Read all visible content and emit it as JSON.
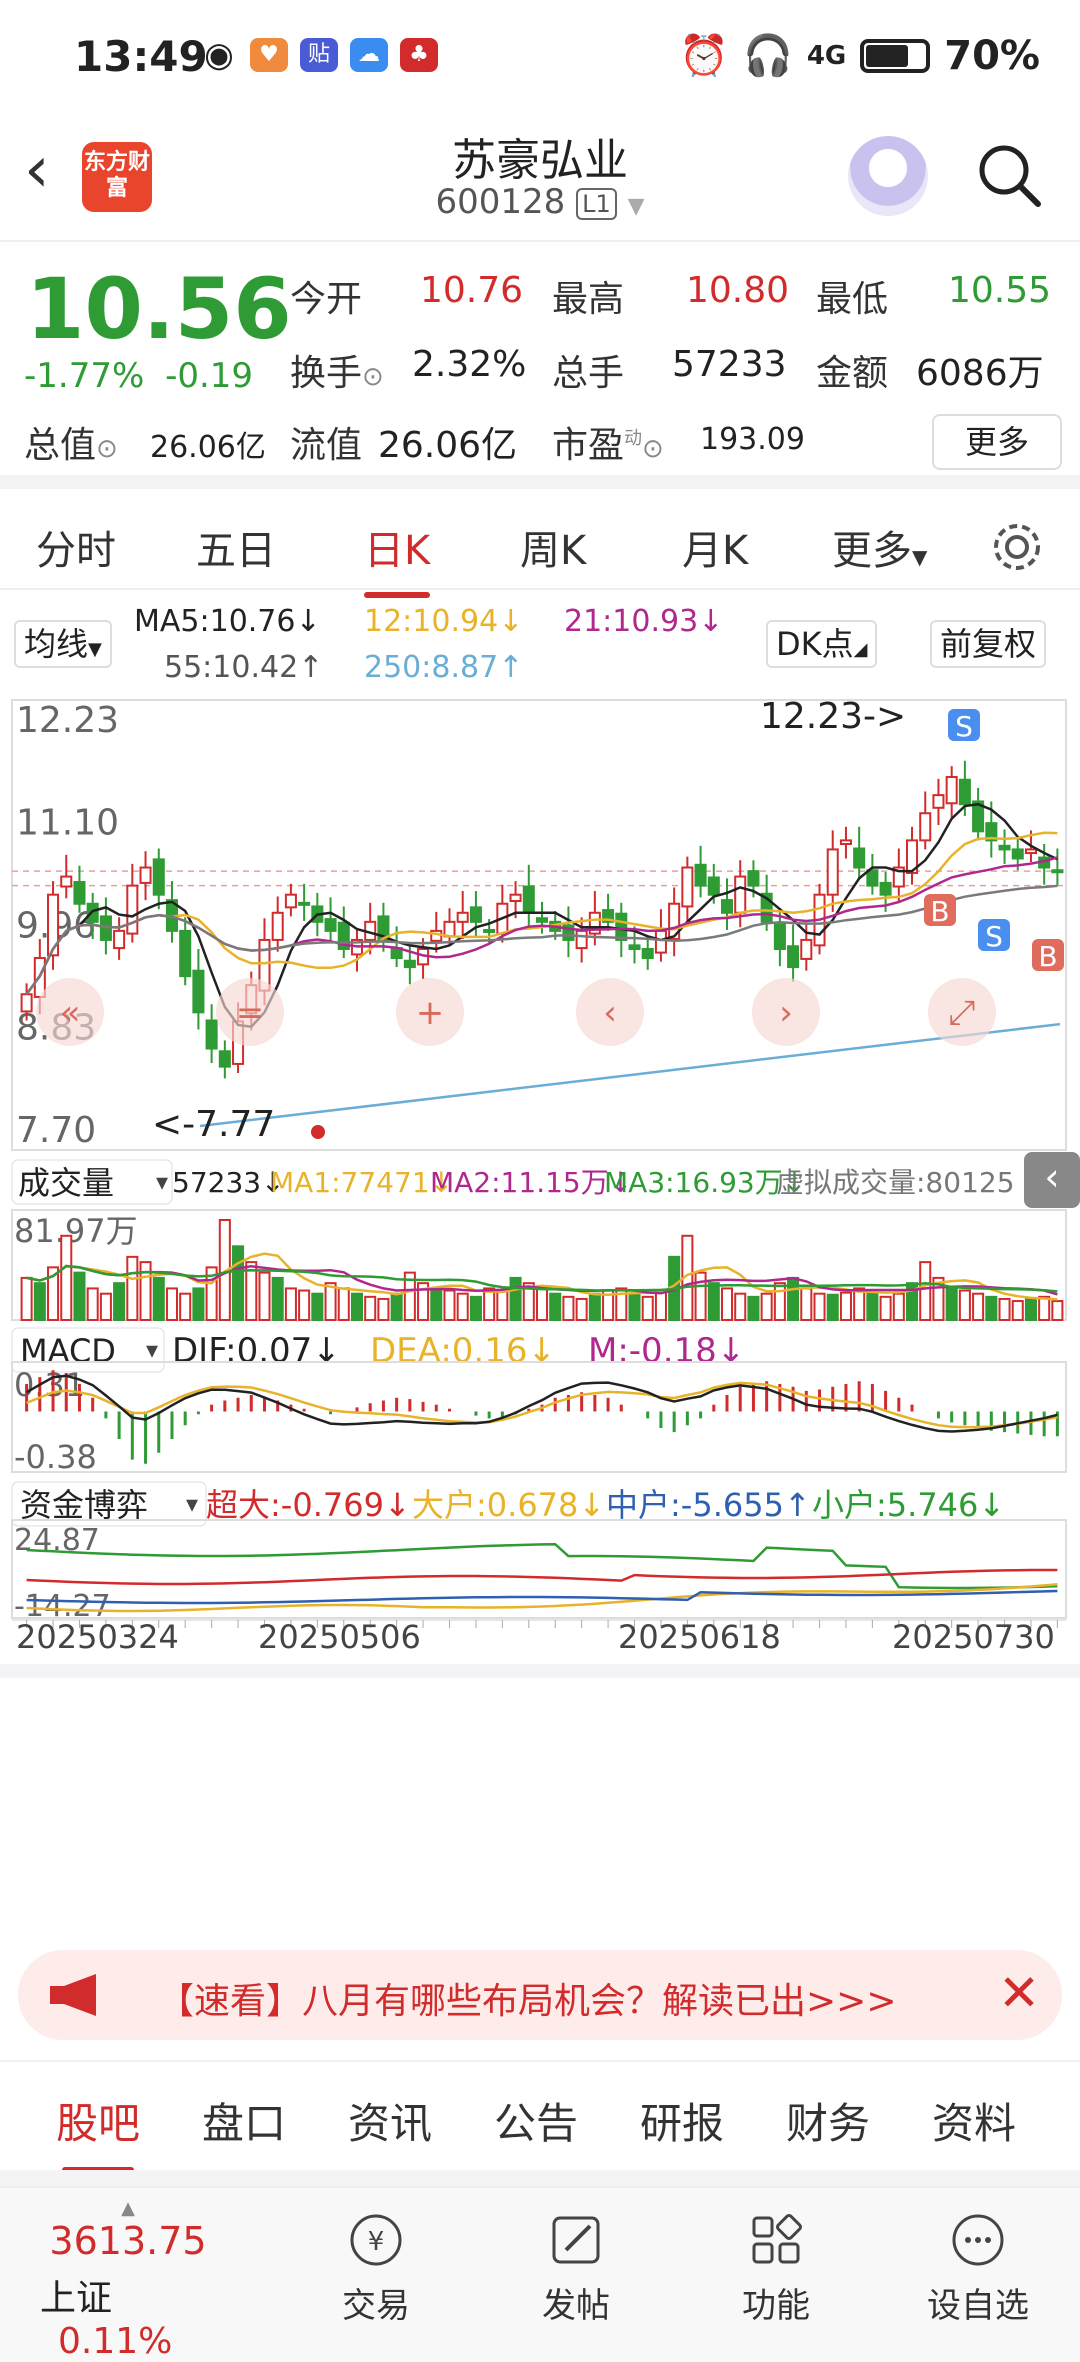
{
  "status_bar": {
    "time": "13:49",
    "battery": "70%",
    "network": "4G"
  },
  "header": {
    "logo": "东方财富",
    "stock_name": "苏豪弘业",
    "stock_code": "600128",
    "market_badge": "L1"
  },
  "quote": {
    "price": "10.56",
    "change_pct": "-1.77%",
    "change": "-0.19",
    "open_label": "今开",
    "open": "10.76",
    "high_label": "最高",
    "high": "10.80",
    "low_label": "最低",
    "low": "10.55",
    "turnover_label": "换手",
    "turnover": "2.32%",
    "volume_label": "总手",
    "volume": "57233",
    "amount_label": "金额",
    "amount": "6086万",
    "mktcap_label": "总值",
    "mktcap": "26.06亿",
    "float_label": "流值",
    "float_cap": "26.06亿",
    "pe_label": "市盈",
    "pe_sup": "动",
    "pe": "193.09",
    "more": "更多"
  },
  "k_tabs": [
    "分时",
    "五日",
    "日K",
    "周K",
    "月K",
    "更多"
  ],
  "active_k_tab": "日K",
  "ma_row": {
    "selector": "均线",
    "ma5": "MA5:10.76↓",
    "ma12": "12:10.94↓",
    "ma21": "21:10.93↓",
    "ma55": "55:10.42↑",
    "ma250": "250:8.87↑",
    "dk": "DK点",
    "fuquan": "前复权"
  },
  "colors": {
    "up": "#d12b2b",
    "down": "#2e9b34",
    "ma5": "#222222",
    "ma12": "#e8b32a",
    "ma21": "#b0288e",
    "ma55": "#7a7a7a",
    "ma250": "#6aaed6"
  },
  "chart_data": [
    {
      "type": "candlestick",
      "title": "日K",
      "y_ticks": [
        "12.23",
        "11.10",
        "9.96",
        "8.83",
        "7.70"
      ],
      "ylim": [
        7.7,
        12.23
      ],
      "x_ticks": [
        "20250324",
        "20250506",
        "20250618",
        "20250730"
      ],
      "annotations": [
        "12.23->",
        "<-7.77"
      ],
      "markers": [
        "S",
        "S",
        "B",
        "S",
        "B"
      ],
      "close_series": [
        9.2,
        9.6,
        10.3,
        10.5,
        10.2,
        10.0,
        9.8,
        9.9,
        10.4,
        10.6,
        10.3,
        9.9,
        9.4,
        9.0,
        8.6,
        8.4,
        8.9,
        9.3,
        9.8,
        10.1,
        10.3,
        10.2,
        10.0,
        9.9,
        9.7,
        9.8,
        10.0,
        9.8,
        9.6,
        9.5,
        9.7,
        9.9,
        10.0,
        10.1,
        10.0,
        9.9,
        10.2,
        10.3,
        10.1,
        10.0,
        9.9,
        9.8,
        9.9,
        10.1,
        10.0,
        9.8,
        9.7,
        9.6,
        9.9,
        10.2,
        10.6,
        10.4,
        10.3,
        10.1,
        10.5,
        10.4,
        10.0,
        9.7,
        9.5,
        9.8,
        10.3,
        10.8,
        10.9,
        10.6,
        10.4,
        10.3,
        10.6,
        10.9,
        11.2,
        11.4,
        11.6,
        11.3,
        11.0,
        10.9,
        10.8,
        10.7,
        10.8,
        10.6,
        10.56
      ],
      "ma250": [
        7.7,
        8.87
      ]
    },
    {
      "type": "bar",
      "title": "成交量",
      "labels": [
        "57233↓",
        "MA1:77471↓",
        "MA2:11.15万↓",
        "MA3:16.93万↓",
        "虚拟成交量:80125"
      ],
      "y_ticks": [
        "81.97万"
      ],
      "values": [
        40,
        35,
        50,
        80,
        45,
        30,
        25,
        35,
        60,
        55,
        40,
        30,
        25,
        30,
        50,
        95,
        70,
        55,
        45,
        40,
        30,
        28,
        25,
        35,
        30,
        25,
        22,
        20,
        25,
        45,
        35,
        30,
        28,
        25,
        22,
        30,
        28,
        40,
        35,
        30,
        25,
        22,
        20,
        25,
        28,
        30,
        24,
        22,
        28,
        60,
        80,
        45,
        35,
        30,
        25,
        22,
        25,
        35,
        40,
        30,
        25,
        24,
        26,
        30,
        28,
        22,
        25,
        35,
        55,
        40,
        30,
        28,
        25,
        22,
        20,
        18,
        20,
        22,
        18
      ]
    },
    {
      "type": "bar",
      "title": "MACD",
      "labels": [
        "DIF:0.07↓",
        "DEA:0.16↓",
        "M:-0.18↓"
      ],
      "y_ticks": [
        "0.31",
        "-0.38"
      ],
      "values": [
        0.2,
        0.25,
        0.3,
        0.28,
        0.2,
        0.1,
        -0.05,
        -0.2,
        -0.35,
        -0.38,
        -0.3,
        -0.2,
        -0.1,
        -0.02,
        0.05,
        0.08,
        0.1,
        0.12,
        0.1,
        0.08,
        0.05,
        0.02,
        0.0,
        -0.02,
        0.0,
        0.03,
        0.06,
        0.08,
        0.1,
        0.09,
        0.07,
        0.05,
        0.02,
        0.0,
        -0.03,
        -0.05,
        -0.04,
        -0.02,
        0.02,
        0.05,
        0.1,
        0.12,
        0.14,
        0.12,
        0.1,
        0.05,
        0.0,
        -0.05,
        -0.12,
        -0.15,
        -0.1,
        -0.05,
        0.05,
        0.12,
        0.18,
        0.2,
        0.22,
        0.2,
        0.18,
        0.15,
        0.16,
        0.18,
        0.2,
        0.22,
        0.2,
        0.15,
        0.1,
        0.05,
        0.0,
        -0.05,
        -0.08,
        -0.1,
        -0.12,
        -0.14,
        -0.15,
        -0.16,
        -0.17,
        -0.18,
        -0.18
      ]
    },
    {
      "type": "line",
      "title": "资金博弈",
      "labels": [
        "超大:-0.769↓",
        "大户:0.678↓",
        "中户:-5.655↑",
        "小户:5.746↓"
      ],
      "y_ticks": [
        "24.87",
        "-14.27"
      ]
    }
  ],
  "banner": {
    "text": "【速看】八月有哪些布局机会？解读已出>>>"
  },
  "bottom_tabs": [
    "股吧",
    "盘口",
    "资讯",
    "公告",
    "研报",
    "财务",
    "资料"
  ],
  "active_bottom_tab": "股吧",
  "nav": {
    "index_value": "3613.75",
    "index_name": "上证",
    "index_change": "0.11%",
    "items": [
      "交易",
      "发帖",
      "功能",
      "设自选"
    ]
  }
}
